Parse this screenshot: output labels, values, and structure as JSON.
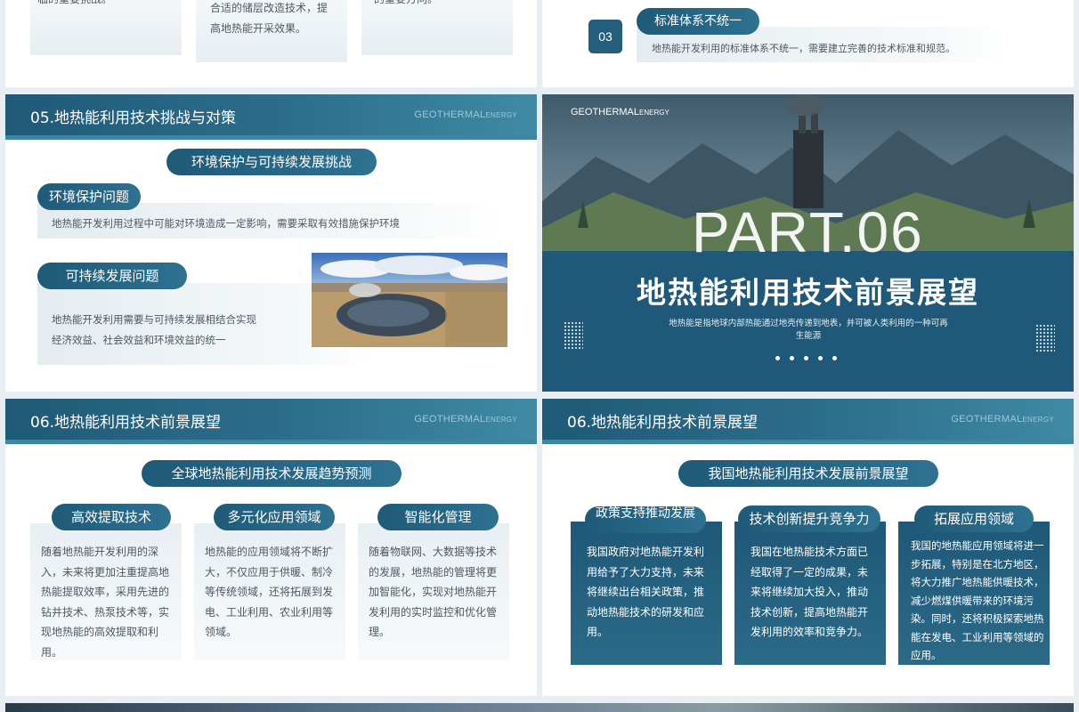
{
  "brand": {
    "main": "GEOTHERMAL",
    "sub": "ENERGY"
  },
  "top_left": {
    "frag1": "临的重要挑战。",
    "frag2": [
      "合适的储层改造技术，提",
      "高地热能开采效果。"
    ],
    "frag3": "的重要方向。"
  },
  "top_right": {
    "num": "03",
    "title": "标准体系不统一",
    "desc": "地热能开发利用的标准体系不统一，需要建立完善的技术标准和规范。"
  },
  "slide05": {
    "header": "05.地热能利用技术挑战与对策",
    "main_pill": "环境保护与可持续发展挑战",
    "item1": {
      "title": "环境保护问题",
      "desc": "地热能开发利用过程中可能对环境造成一定影响，需要采取有效措施保护环境"
    },
    "item2": {
      "title": "可持续发展问题",
      "desc": [
        "地热能开发利用需要与可持续发展相结合实现",
        "经济效益、社会效益和环境效益的统一"
      ]
    }
  },
  "cover": {
    "part": "PART.06",
    "title": "地热能利用技术前景展望",
    "desc": "地热能是指地球内部热能通过地壳传递到地表，并可被人类利用的一种可再生能源"
  },
  "slide06a": {
    "header": "06.地热能利用技术前景展望",
    "main_pill": "全球地热能利用技术发展趋势预测",
    "cards": [
      {
        "title": "高效提取技术",
        "text": "随着地热能开发利用的深入，未来将更加注重提高地热能提取效率，采用先进的钻井技术、热泵技术等，实现地热能的高效提取和利用。"
      },
      {
        "title": "多元化应用领域",
        "text": "地热能的应用领域将不断扩大，不仅应用于供暖、制冷等传统领域，还将拓展到发电、工业利用、农业利用等领域。"
      },
      {
        "title": "智能化管理",
        "text": "随着物联网、大数据等技术的发展，地热能的管理将更加智能化，实现对地热能开发利用的实时监控和优化管理。"
      }
    ]
  },
  "slide06b": {
    "header": "06.地热能利用技术前景展望",
    "main_pill": "我国地热能利用技术发展前景展望",
    "cards": [
      {
        "title": "政策支持推动发展",
        "text": "我国政府对地热能开发利用给予了大力支持，未来将继续出台相关政策，推动地热能技术的研发和应用。"
      },
      {
        "title": "技术创新提升竞争力",
        "text": "我国在地热能技术方面已经取得了一定的成果，未来将继续加大投入，推动技术创新，提高地热能开发利用的效率和竞争力。"
      },
      {
        "title": "拓展应用领域",
        "text": "我国的地热能应用领域将进一步拓展，特别是在北方地区，将大力推广地热能供暖技术，减少燃煤供暖带来的环境污染。同时，还将积极探索地热能在发电、工业利用等领域的应用。"
      }
    ]
  }
}
